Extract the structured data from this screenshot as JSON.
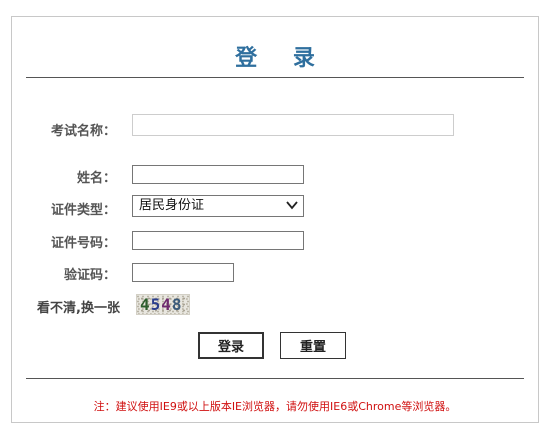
{
  "title": "登 录",
  "form": {
    "exam_name_label": "考试名称：",
    "name_label": "姓名：",
    "id_type_label": "证件类型：",
    "id_type_value": "居民身份证",
    "id_number_label": "证件号码：",
    "captcha_label": "验证码：",
    "refresh_captcha_text": "看不清,换一张",
    "captcha_digits": [
      "4",
      "5",
      "4",
      "8"
    ]
  },
  "buttons": {
    "login": "登录",
    "reset": "重置"
  },
  "footer_note": "注：建议使用IE9或以上版本IE浏览器，请勿使用IE6或Chrome等浏览器。",
  "colors": {
    "title": "#2f6f9e",
    "note": "#d01010"
  }
}
